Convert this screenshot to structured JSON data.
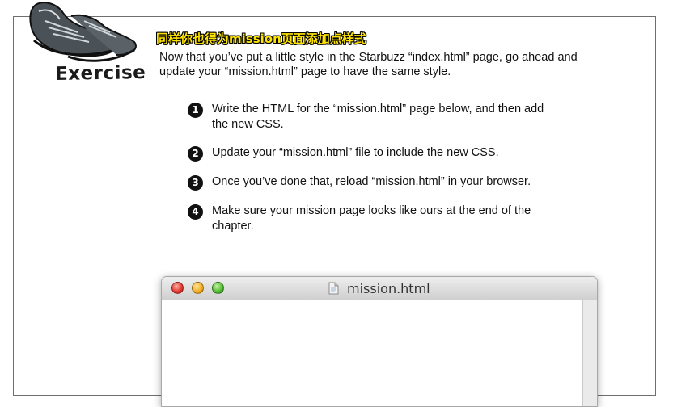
{
  "badge": {
    "label": "Exercise"
  },
  "title_cn": "同样你也得为mission页面添加点样式",
  "intro": "Now that you’ve put a little style in the Starbuzz “index.html” page, go ahead and update your “mission.html” page to have the same style.",
  "steps": [
    {
      "num": "1",
      "text": "Write the HTML for the “mission.html” page below, and then add the new CSS."
    },
    {
      "num": "2",
      "text": "Update your “mission.html” file to include the new CSS."
    },
    {
      "num": "3",
      "text": "Once you’ve done that, reload “mission.html” in your browser."
    },
    {
      "num": "4",
      "text": "Make sure your mission page looks like ours at the end of the chapter."
    }
  ],
  "browser": {
    "title": "mission.html",
    "icon": "document-icon"
  },
  "icons": {
    "badge_art": "running-shoes-icon"
  }
}
